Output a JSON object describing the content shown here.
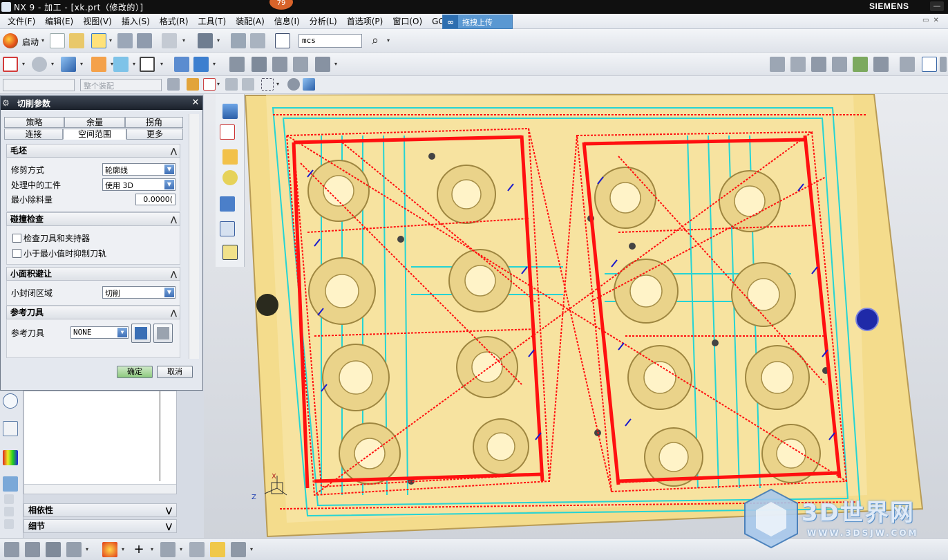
{
  "app": {
    "title": "NX 9 - 加工 - [xk.prt（修改的）]",
    "brand": "SIEMENS",
    "notice_badge": "79"
  },
  "menu": [
    "文件(F)",
    "编辑(E)",
    "视图(V)",
    "插入(S)",
    "格式(R)",
    "工具(T)",
    "装配(A)",
    "信息(I)",
    "分析(L)",
    "首选项(P)",
    "窗口(O)",
    "GC"
  ],
  "upload_button": {
    "label": "拖拽上传"
  },
  "toolbar": {
    "start_label": "启动",
    "search_value": "mcs",
    "filter_combo": "",
    "assembly_combo": "整个装配"
  },
  "dialog": {
    "title": "切削参数",
    "tabs_row1": [
      "策略",
      "余量",
      "拐角"
    ],
    "tabs_row2": [
      "连接",
      "空间范围",
      "更多"
    ],
    "active_tab": "空间范围",
    "sections": {
      "blank": {
        "header": "毛坯",
        "trim_label": "修剪方式",
        "trim_value": "轮廓线",
        "ipw_label": "处理中的工件",
        "ipw_value": "使用 3D",
        "min_removal_label": "最小除料量",
        "min_removal_value": "0.0000("
      },
      "collision": {
        "header": "碰撞检查",
        "check_tool_label": "检查刀具和夹持器",
        "suppress_label": "小于最小值时抑制刀轨"
      },
      "small_area": {
        "header": "小面积避让",
        "closed_area_label": "小封闭区域",
        "closed_area_value": "切削"
      },
      "ref_tool": {
        "header": "参考刀具",
        "ref_tool_label": "参考刀具",
        "ref_tool_value": "NONE"
      }
    },
    "ok_label": "确定",
    "cancel_label": "取消"
  },
  "nav_panel": {
    "dependencies_label": "相依性",
    "details_label": "细节"
  },
  "viewport": {
    "triad_z": "Z",
    "triad_x": "X"
  },
  "watermark": {
    "text": "3D世界网",
    "url": "WWW.3DSJW.COM"
  },
  "colors": {
    "part": "#f5dc8f",
    "toolpath_red": "#ff1010",
    "toolpath_blue": "#1a1acc",
    "toolpath_cyan": "#26d6d6",
    "dialog_ok": "#8dc97e"
  }
}
